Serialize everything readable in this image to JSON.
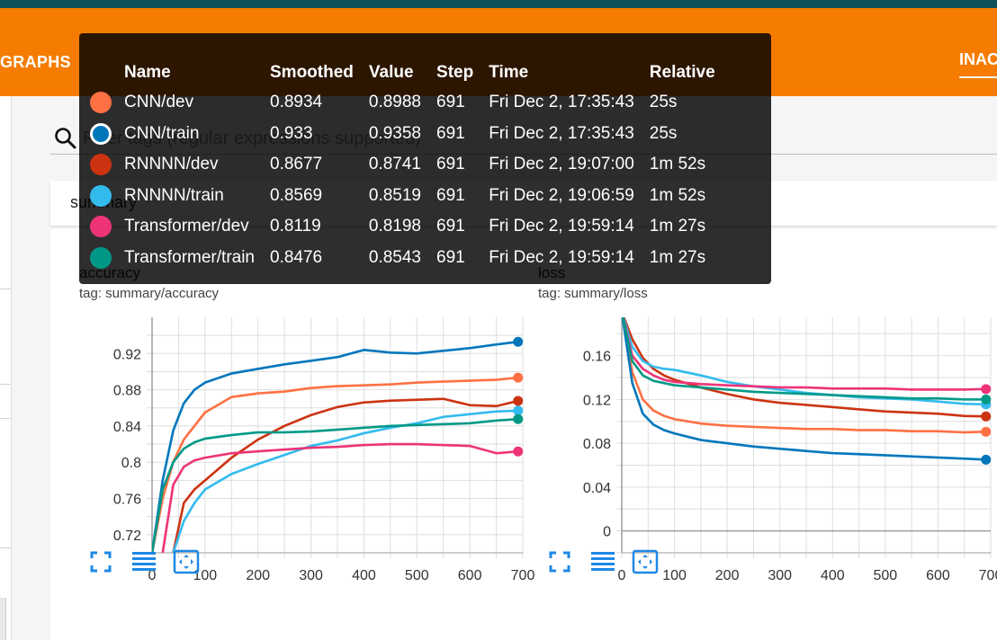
{
  "header": {
    "nav_graphs": "GRAPHS",
    "nav_inactive": "INAC",
    "brand_color": "#f57c00"
  },
  "search": {
    "placeholder": "Filter tags (regular expressions supported)"
  },
  "section": {
    "title": "summary"
  },
  "tooltip": {
    "columns": [
      "Name",
      "Smoothed",
      "Value",
      "Step",
      "Time",
      "Relative"
    ],
    "rows": [
      {
        "color": "#ff7043",
        "name": "CNN/dev",
        "smoothed": "0.8934",
        "value": "0.8988",
        "step": "691",
        "time": "Fri Dec 2, 17:35:43",
        "relative": "25s",
        "selected": false
      },
      {
        "color": "#0077bb",
        "name": "CNN/train",
        "smoothed": "0.933",
        "value": "0.9358",
        "step": "691",
        "time": "Fri Dec 2, 17:35:43",
        "relative": "25s",
        "selected": true
      },
      {
        "color": "#cc3311",
        "name": "RNNNN/dev",
        "smoothed": "0.8677",
        "value": "0.8741",
        "step": "691",
        "time": "Fri Dec 2, 19:07:00",
        "relative": "1m 52s",
        "selected": false
      },
      {
        "color": "#33bbee",
        "name": "RNNNN/train",
        "smoothed": "0.8569",
        "value": "0.8519",
        "step": "691",
        "time": "Fri Dec 2, 19:06:59",
        "relative": "1m 52s",
        "selected": false
      },
      {
        "color": "#ee3377",
        "name": "Transformer/dev",
        "smoothed": "0.8119",
        "value": "0.8198",
        "step": "691",
        "time": "Fri Dec 2, 19:59:14",
        "relative": "1m 27s",
        "selected": false
      },
      {
        "color": "#009988",
        "name": "Transformer/train",
        "smoothed": "0.8476",
        "value": "0.8543",
        "step": "691",
        "time": "Fri Dec 2, 19:59:14",
        "relative": "1m 27s",
        "selected": false
      }
    ]
  },
  "cards": {
    "accuracy": {
      "title": "accuracy",
      "tag": "tag: summary/accuracy"
    },
    "loss": {
      "title": "loss",
      "tag": "tag: summary/loss"
    }
  },
  "chart_data": [
    {
      "type": "line",
      "title": "accuracy",
      "xlim": [
        0,
        700
      ],
      "ylim": [
        0.7,
        0.96
      ],
      "x_ticks": [
        0,
        100,
        200,
        300,
        400,
        500,
        600,
        700
      ],
      "y_ticks": [
        0.72,
        0.76,
        0.8,
        0.84,
        0.88,
        0.92
      ],
      "y_tick_labels": [
        "0.72",
        "0.76",
        "0.8",
        "0.84",
        "0.88",
        "0.92"
      ],
      "grid": true,
      "series": [
        {
          "name": "CNN/dev",
          "color": "#ff7043",
          "x": [
            0,
            20,
            40,
            60,
            80,
            100,
            150,
            200,
            250,
            300,
            350,
            400,
            450,
            500,
            550,
            600,
            650,
            691
          ],
          "y": [
            0.7,
            0.76,
            0.8,
            0.825,
            0.84,
            0.855,
            0.872,
            0.876,
            0.878,
            0.882,
            0.884,
            0.885,
            0.886,
            0.888,
            0.889,
            0.89,
            0.891,
            0.8934
          ]
        },
        {
          "name": "CNN/train",
          "color": "#0077bb",
          "x": [
            0,
            20,
            40,
            60,
            80,
            100,
            150,
            200,
            250,
            300,
            350,
            400,
            450,
            500,
            550,
            600,
            650,
            691
          ],
          "y": [
            0.7,
            0.78,
            0.835,
            0.865,
            0.88,
            0.888,
            0.898,
            0.903,
            0.908,
            0.912,
            0.916,
            0.924,
            0.921,
            0.92,
            0.923,
            0.926,
            0.93,
            0.933
          ]
        },
        {
          "name": "RNNNN/dev",
          "color": "#cc3311",
          "x": [
            40,
            60,
            80,
            100,
            150,
            200,
            250,
            300,
            350,
            400,
            450,
            500,
            550,
            600,
            650,
            691
          ],
          "y": [
            0.7,
            0.755,
            0.77,
            0.78,
            0.805,
            0.825,
            0.84,
            0.852,
            0.861,
            0.866,
            0.868,
            0.869,
            0.87,
            0.863,
            0.862,
            0.8677
          ]
        },
        {
          "name": "RNNNN/train",
          "color": "#33bbee",
          "x": [
            40,
            60,
            80,
            100,
            150,
            200,
            250,
            300,
            350,
            400,
            450,
            500,
            550,
            600,
            650,
            691
          ],
          "y": [
            0.7,
            0.735,
            0.755,
            0.77,
            0.787,
            0.798,
            0.808,
            0.818,
            0.824,
            0.832,
            0.838,
            0.843,
            0.85,
            0.853,
            0.856,
            0.8569
          ]
        },
        {
          "name": "Transformer/dev",
          "color": "#ee3377",
          "x": [
            20,
            40,
            60,
            80,
            100,
            150,
            200,
            250,
            300,
            350,
            400,
            450,
            500,
            550,
            600,
            650,
            691
          ],
          "y": [
            0.7,
            0.775,
            0.795,
            0.802,
            0.805,
            0.81,
            0.812,
            0.814,
            0.816,
            0.817,
            0.819,
            0.82,
            0.82,
            0.819,
            0.818,
            0.81,
            0.8119
          ]
        },
        {
          "name": "Transformer/train",
          "color": "#009988",
          "x": [
            0,
            20,
            40,
            60,
            80,
            100,
            150,
            200,
            250,
            300,
            350,
            400,
            450,
            500,
            550,
            600,
            650,
            691
          ],
          "y": [
            0.7,
            0.77,
            0.8,
            0.815,
            0.822,
            0.826,
            0.83,
            0.833,
            0.833,
            0.834,
            0.836,
            0.838,
            0.84,
            0.841,
            0.842,
            0.843,
            0.846,
            0.8476
          ]
        }
      ]
    },
    {
      "type": "line",
      "title": "loss",
      "xlim": [
        0,
        700
      ],
      "ylim": [
        -0.02,
        0.195
      ],
      "x_ticks": [
        0,
        100,
        200,
        300,
        400,
        500,
        600,
        700
      ],
      "y_ticks": [
        0,
        0.04,
        0.08,
        0.12,
        0.16
      ],
      "y_tick_labels": [
        "0",
        "0.04",
        "0.08",
        "0.12",
        "0.16"
      ],
      "grid": true,
      "series": [
        {
          "name": "CNN/dev",
          "color": "#ff7043",
          "x": [
            0,
            20,
            40,
            60,
            80,
            100,
            150,
            200,
            250,
            300,
            350,
            400,
            450,
            500,
            550,
            600,
            650,
            691
          ],
          "y": [
            0.2,
            0.145,
            0.12,
            0.11,
            0.105,
            0.102,
            0.098,
            0.096,
            0.095,
            0.094,
            0.093,
            0.093,
            0.092,
            0.092,
            0.091,
            0.091,
            0.09,
            0.0905
          ]
        },
        {
          "name": "CNN/train",
          "color": "#0077bb",
          "x": [
            0,
            20,
            40,
            60,
            80,
            100,
            150,
            200,
            250,
            300,
            350,
            400,
            450,
            500,
            550,
            600,
            650,
            691
          ],
          "y": [
            0.2,
            0.135,
            0.107,
            0.097,
            0.092,
            0.089,
            0.083,
            0.08,
            0.077,
            0.075,
            0.073,
            0.071,
            0.07,
            0.069,
            0.068,
            0.067,
            0.066,
            0.065
          ]
        },
        {
          "name": "RNNNN/dev",
          "color": "#cc3311",
          "x": [
            0,
            20,
            40,
            60,
            80,
            100,
            150,
            200,
            250,
            300,
            350,
            400,
            450,
            500,
            550,
            600,
            650,
            691
          ],
          "y": [
            0.2,
            0.175,
            0.158,
            0.148,
            0.142,
            0.138,
            0.131,
            0.125,
            0.12,
            0.117,
            0.115,
            0.113,
            0.111,
            0.109,
            0.108,
            0.107,
            0.105,
            0.1045
          ]
        },
        {
          "name": "RNNNN/train",
          "color": "#33bbee",
          "x": [
            0,
            20,
            40,
            60,
            80,
            100,
            150,
            200,
            250,
            300,
            350,
            400,
            450,
            500,
            550,
            600,
            650,
            691
          ],
          "y": [
            0.2,
            0.168,
            0.155,
            0.15,
            0.148,
            0.147,
            0.142,
            0.136,
            0.132,
            0.129,
            0.126,
            0.124,
            0.122,
            0.121,
            0.12,
            0.118,
            0.116,
            0.1155
          ]
        },
        {
          "name": "Transformer/dev",
          "color": "#ee3377",
          "x": [
            0,
            20,
            40,
            60,
            80,
            100,
            150,
            200,
            250,
            300,
            350,
            400,
            450,
            500,
            550,
            600,
            650,
            691
          ],
          "y": [
            0.2,
            0.16,
            0.148,
            0.142,
            0.138,
            0.136,
            0.134,
            0.133,
            0.132,
            0.131,
            0.131,
            0.13,
            0.13,
            0.13,
            0.129,
            0.129,
            0.129,
            0.1295
          ]
        },
        {
          "name": "Transformer/train",
          "color": "#009988",
          "x": [
            0,
            20,
            40,
            60,
            80,
            100,
            150,
            200,
            250,
            300,
            350,
            400,
            450,
            500,
            550,
            600,
            650,
            691
          ],
          "y": [
            0.2,
            0.155,
            0.142,
            0.137,
            0.135,
            0.133,
            0.131,
            0.129,
            0.127,
            0.126,
            0.125,
            0.124,
            0.123,
            0.122,
            0.121,
            0.121,
            0.12,
            0.12
          ]
        }
      ]
    }
  ]
}
